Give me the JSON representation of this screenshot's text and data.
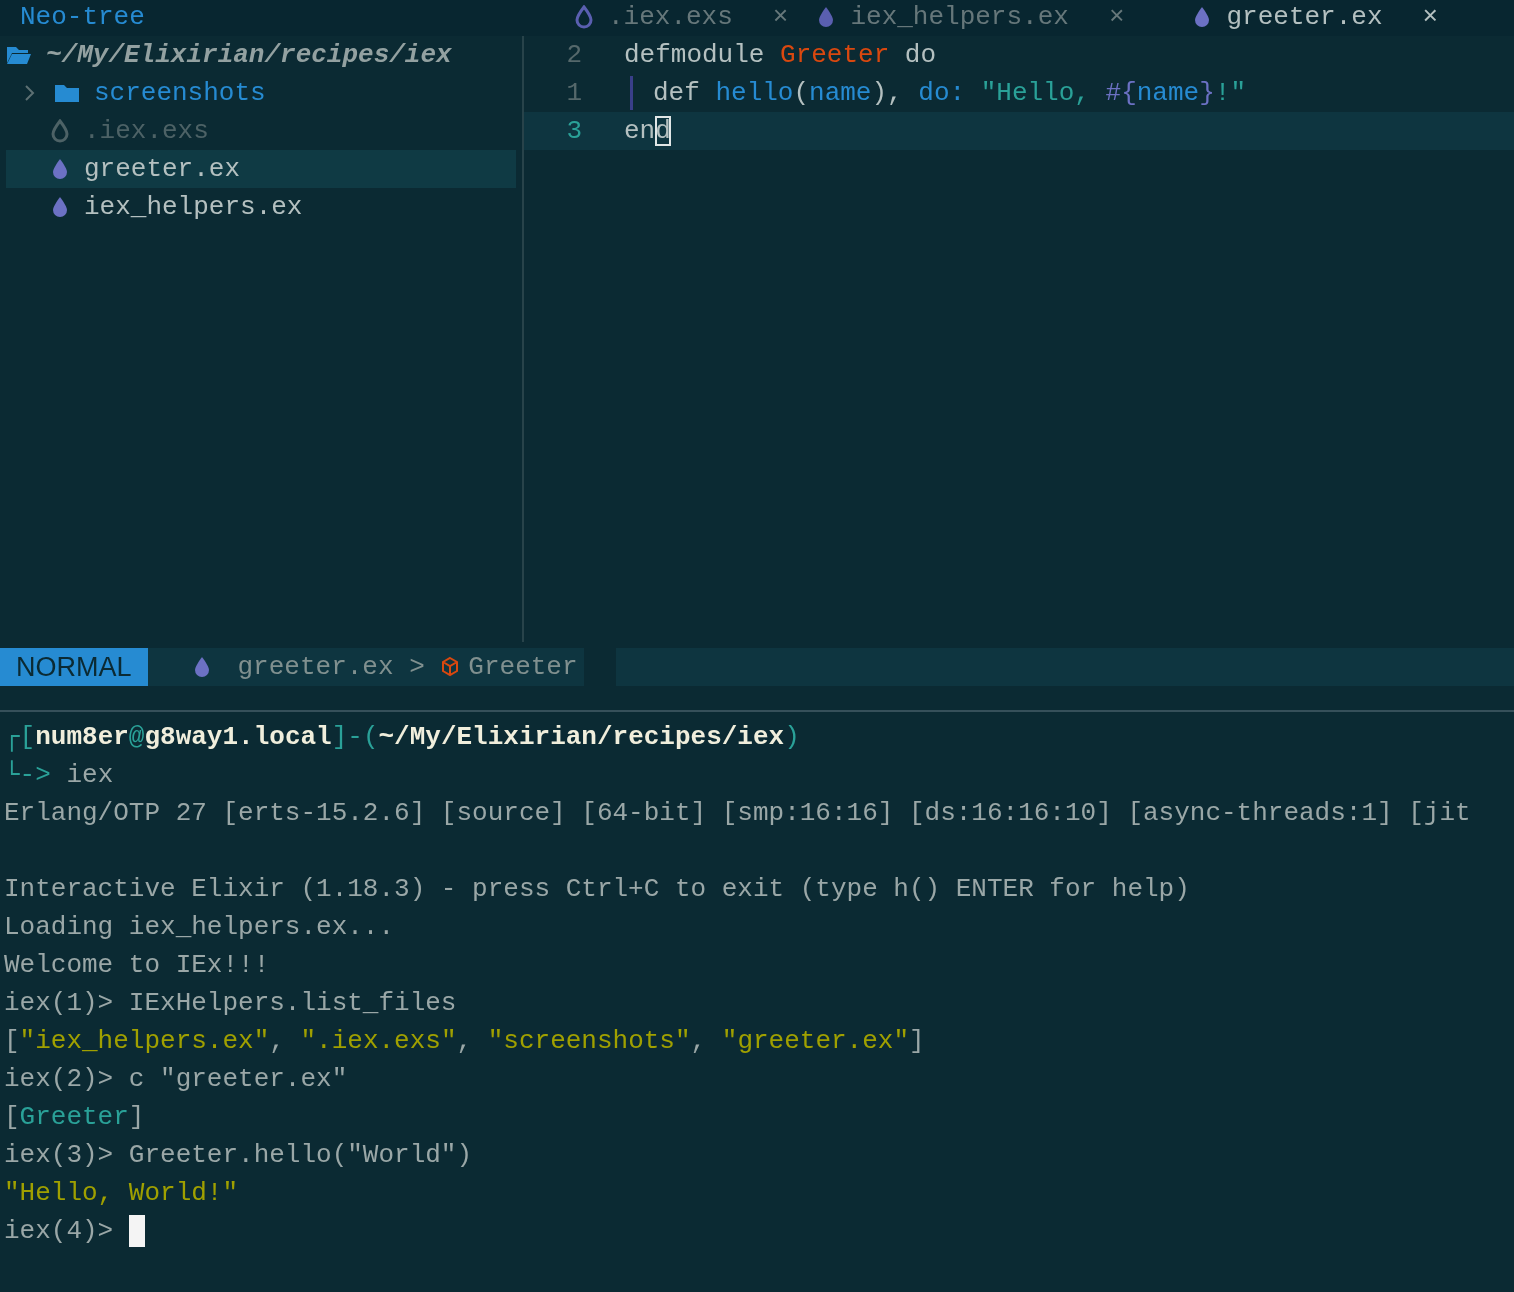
{
  "sidebar": {
    "title": "Neo-tree",
    "root": "~/My/Elixirian/recipes/iex",
    "items": [
      {
        "name": "screenshots",
        "kind": "folder",
        "expanded": false,
        "selected": false,
        "hidden": false
      },
      {
        "name": ".iex.exs",
        "kind": "script",
        "selected": false,
        "hidden": true
      },
      {
        "name": "greeter.ex",
        "kind": "file",
        "selected": true,
        "hidden": false
      },
      {
        "name": "iex_helpers.ex",
        "kind": "file",
        "selected": false,
        "hidden": false
      }
    ]
  },
  "tabs": [
    {
      "label": ".iex.exs",
      "kind": "script",
      "selected": false,
      "close": "×"
    },
    {
      "label": "iex_helpers.ex",
      "kind": "file",
      "selected": false,
      "close": "×"
    },
    {
      "label": "greeter.ex",
      "kind": "file",
      "selected": true,
      "close": "×"
    }
  ],
  "editor": {
    "lines": [
      {
        "number": "2",
        "current": false,
        "guide": false,
        "tokens": [
          {
            "text": "defmodule ",
            "kind": "plain"
          },
          {
            "text": "Greeter",
            "kind": "module"
          },
          {
            "text": " do",
            "kind": "plain"
          }
        ]
      },
      {
        "number": "1",
        "current": false,
        "guide": true,
        "tokens": [
          {
            "text": "def ",
            "kind": "plain"
          },
          {
            "text": "hello",
            "kind": "func"
          },
          {
            "text": "(",
            "kind": "plain"
          },
          {
            "text": "name",
            "kind": "keyword"
          },
          {
            "text": "), ",
            "kind": "plain"
          },
          {
            "text": "do:",
            "kind": "keyword"
          },
          {
            "text": " \"Hello, ",
            "kind": "string"
          },
          {
            "text": "#{",
            "kind": "interp"
          },
          {
            "text": "name",
            "kind": "keyword"
          },
          {
            "text": "}",
            "kind": "interp"
          },
          {
            "text": "!\"",
            "kind": "string"
          }
        ]
      },
      {
        "number": "3",
        "current": true,
        "guide": false,
        "tokens": [
          {
            "text": "en",
            "kind": "plain"
          },
          {
            "text": "d",
            "kind": "cursor"
          }
        ]
      }
    ]
  },
  "statusline": {
    "mode": "NORMAL",
    "file": "greeter.ex",
    "separator": ">",
    "symbol": "Greeter"
  },
  "terminal": {
    "prompt": {
      "open": "┌[",
      "user": "num8er",
      "at": "@",
      "host": "g8way1.local",
      "mid": "]-(",
      "path": "~/My/Elixirian/recipes/iex",
      "close": ")",
      "arrow": "└->",
      "command": "iex"
    },
    "lines": [
      {
        "kind": "text",
        "tokens": [
          {
            "text": "Erlang/OTP 27 [erts-15.2.6] [source] [64-bit] [smp:16:16] [ds:16:16:10] [async-threads:1] [jit",
            "kind": "plain"
          }
        ]
      },
      {
        "kind": "blank"
      },
      {
        "kind": "text",
        "tokens": [
          {
            "text": "Interactive Elixir (1.18.3) - press Ctrl+C to exit (type h() ENTER for help)",
            "kind": "plain"
          }
        ]
      },
      {
        "kind": "text",
        "tokens": [
          {
            "text": "Loading iex_helpers.ex...",
            "kind": "plain"
          }
        ]
      },
      {
        "kind": "text",
        "tokens": [
          {
            "text": "Welcome to IEx!!!",
            "kind": "plain"
          }
        ]
      },
      {
        "kind": "text",
        "tokens": [
          {
            "text": "iex(1)> IExHelpers.list_files",
            "kind": "plain"
          }
        ]
      },
      {
        "kind": "text",
        "tokens": [
          {
            "text": "[",
            "kind": "plain"
          },
          {
            "text": "\"iex_helpers.ex\"",
            "kind": "string"
          },
          {
            "text": ", ",
            "kind": "plain"
          },
          {
            "text": "\".iex.exs\"",
            "kind": "string"
          },
          {
            "text": ", ",
            "kind": "plain"
          },
          {
            "text": "\"screenshots\"",
            "kind": "string"
          },
          {
            "text": ", ",
            "kind": "plain"
          },
          {
            "text": "\"greeter.ex\"",
            "kind": "string"
          },
          {
            "text": "]",
            "kind": "plain"
          }
        ]
      },
      {
        "kind": "text",
        "tokens": [
          {
            "text": "iex(2)> c \"greeter.ex\"",
            "kind": "plain"
          }
        ]
      },
      {
        "kind": "text",
        "tokens": [
          {
            "text": "[",
            "kind": "plain"
          },
          {
            "text": "Greeter",
            "kind": "module"
          },
          {
            "text": "]",
            "kind": "plain"
          }
        ]
      },
      {
        "kind": "text",
        "tokens": [
          {
            "text": "iex(3)> Greeter.hello(\"World\")",
            "kind": "plain"
          }
        ]
      },
      {
        "kind": "text",
        "tokens": [
          {
            "text": "\"Hello, World!\"",
            "kind": "string"
          }
        ]
      },
      {
        "kind": "text",
        "tokens": [
          {
            "text": "iex(4)> ",
            "kind": "plain"
          },
          {
            "kind": "cursor"
          }
        ]
      }
    ]
  }
}
